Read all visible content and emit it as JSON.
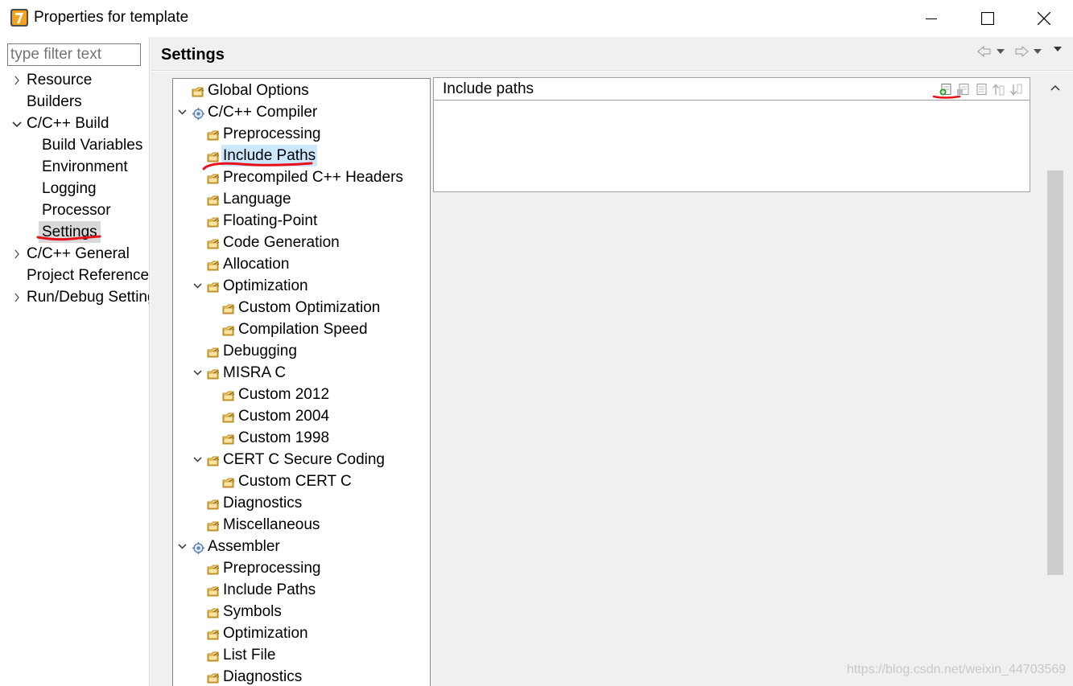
{
  "window": {
    "title": "Properties for template",
    "controls": [
      "minimize",
      "maximize",
      "close"
    ]
  },
  "filter": {
    "placeholder": "type filter text"
  },
  "nav": [
    {
      "label": "Resource",
      "arrow": "›",
      "indent": 0
    },
    {
      "label": "Builders",
      "arrow": "",
      "indent": 0
    },
    {
      "label": "C/C++ Build",
      "arrow": "⌄",
      "indent": 0
    },
    {
      "label": "Build Variables",
      "arrow": "",
      "indent": 1
    },
    {
      "label": "Environment",
      "arrow": "",
      "indent": 1
    },
    {
      "label": "Logging",
      "arrow": "",
      "indent": 1
    },
    {
      "label": "Processor",
      "arrow": "",
      "indent": 1
    },
    {
      "label": "Settings",
      "arrow": "",
      "indent": 1,
      "selected": true
    },
    {
      "label": "C/C++ General",
      "arrow": "›",
      "indent": 0
    },
    {
      "label": "Project References",
      "arrow": "",
      "indent": 0
    },
    {
      "label": "Run/Debug Settings",
      "arrow": "›",
      "indent": 0
    }
  ],
  "header": {
    "title": "Settings"
  },
  "tree": [
    {
      "label": "Global Options",
      "level": 0,
      "icon": "options-icon",
      "expander": false
    },
    {
      "label": "C/C++ Compiler",
      "level": 0,
      "icon": "tool-icon",
      "expander": true
    },
    {
      "label": "Preprocessing",
      "level": 1,
      "icon": "options-icon",
      "expander": false
    },
    {
      "label": "Include Paths",
      "level": 1,
      "icon": "options-icon",
      "expander": false,
      "selected": true
    },
    {
      "label": "Precompiled C++ Headers",
      "level": 1,
      "icon": "options-icon",
      "expander": false
    },
    {
      "label": "Language",
      "level": 1,
      "icon": "options-icon",
      "expander": false
    },
    {
      "label": "Floating-Point",
      "level": 1,
      "icon": "options-icon",
      "expander": false
    },
    {
      "label": "Code Generation",
      "level": 1,
      "icon": "options-icon",
      "expander": false
    },
    {
      "label": "Allocation",
      "level": 1,
      "icon": "options-icon",
      "expander": false
    },
    {
      "label": "Optimization",
      "level": 1,
      "icon": "options-icon",
      "expander": true
    },
    {
      "label": "Custom Optimization",
      "level": 2,
      "icon": "options-icon",
      "expander": false
    },
    {
      "label": "Compilation Speed",
      "level": 2,
      "icon": "options-icon",
      "expander": false
    },
    {
      "label": "Debugging",
      "level": 1,
      "icon": "options-icon",
      "expander": false
    },
    {
      "label": "MISRA C",
      "level": 1,
      "icon": "options-icon",
      "expander": true
    },
    {
      "label": "Custom 2012",
      "level": 2,
      "icon": "options-icon",
      "expander": false
    },
    {
      "label": "Custom 2004",
      "level": 2,
      "icon": "options-icon",
      "expander": false
    },
    {
      "label": "Custom 1998",
      "level": 2,
      "icon": "options-icon",
      "expander": false
    },
    {
      "label": "CERT C Secure Coding",
      "level": 1,
      "icon": "options-icon",
      "expander": true
    },
    {
      "label": "Custom CERT C",
      "level": 2,
      "icon": "options-icon",
      "expander": false
    },
    {
      "label": "Diagnostics",
      "level": 1,
      "icon": "options-icon",
      "expander": false
    },
    {
      "label": "Miscellaneous",
      "level": 1,
      "icon": "options-icon",
      "expander": false
    },
    {
      "label": "Assembler",
      "level": 0,
      "icon": "tool-icon",
      "expander": true
    },
    {
      "label": "Preprocessing",
      "level": 1,
      "icon": "options-icon",
      "expander": false
    },
    {
      "label": "Include Paths",
      "level": 1,
      "icon": "options-icon",
      "expander": false
    },
    {
      "label": "Symbols",
      "level": 1,
      "icon": "options-icon",
      "expander": false
    },
    {
      "label": "Optimization",
      "level": 1,
      "icon": "options-icon",
      "expander": false
    },
    {
      "label": "List File",
      "level": 1,
      "icon": "options-icon",
      "expander": false
    },
    {
      "label": "Diagnostics",
      "level": 1,
      "icon": "options-icon",
      "expander": false
    }
  ],
  "includes": {
    "title": "Include paths",
    "toolbar": [
      "add-icon",
      "add-workspace-icon",
      "edit-icon",
      "move-up-icon",
      "move-down-icon"
    ],
    "items": []
  },
  "watermark": "https://blog.csdn.net/weixin_44703569",
  "colors": {
    "selection": "#cce8ff",
    "annotation": "#e8101a",
    "panel_bg": "#f0f0f0"
  }
}
